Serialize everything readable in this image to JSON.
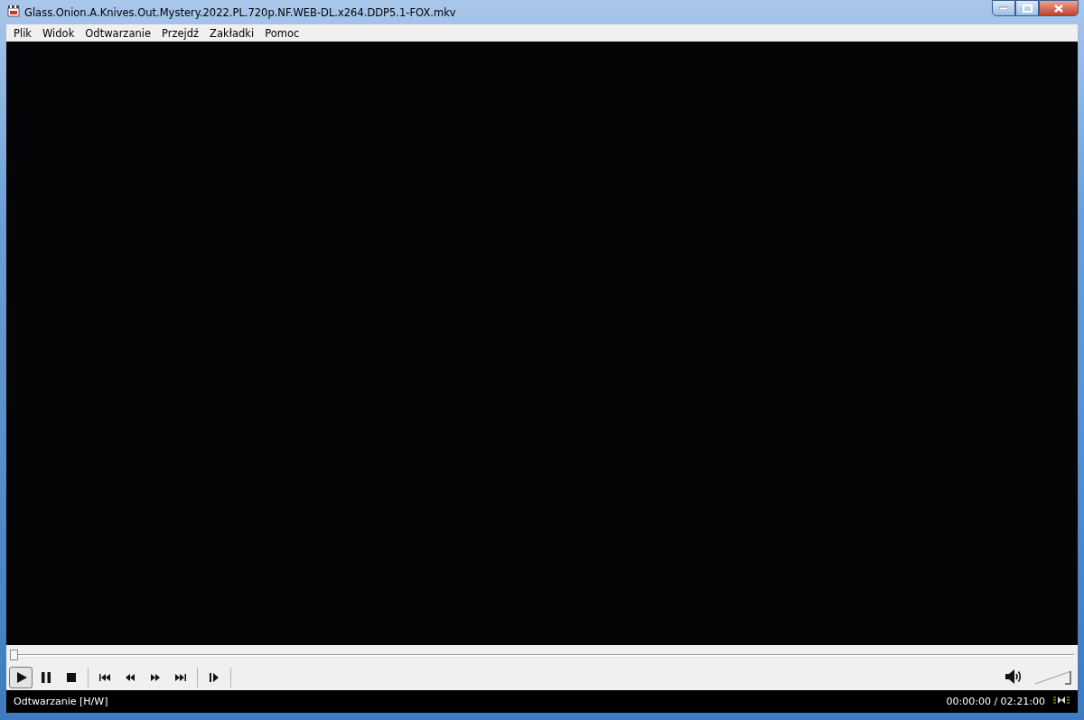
{
  "window": {
    "title": "Glass.Onion.A.Knives.Out.Mystery.2022.PL.720p.NF.WEB-DL.x264.DDP5.1-FOX.mkv"
  },
  "menu": [
    "Plik",
    "Widok",
    "Odtwarzanie",
    "Przejdź",
    "Zakładki",
    "Pomoc"
  ],
  "seek": {
    "level": 0
  },
  "controls": [
    {
      "kind": "play",
      "selected": true
    },
    {
      "kind": "pause",
      "selected": false
    },
    {
      "kind": "stop",
      "selected": false
    },
    {
      "kind": "sep"
    },
    {
      "kind": "prev",
      "selected": false
    },
    {
      "kind": "rewind",
      "selected": false
    },
    {
      "kind": "forward",
      "selected": false
    },
    {
      "kind": "next",
      "selected": false
    },
    {
      "kind": "sep"
    },
    {
      "kind": "step",
      "selected": false
    },
    {
      "kind": "sep"
    }
  ],
  "volume": {
    "level": 1
  },
  "status_bar": {
    "state": "Odtwarzanie [H/W]",
    "time": "00:00:00 / 02:21:00"
  }
}
